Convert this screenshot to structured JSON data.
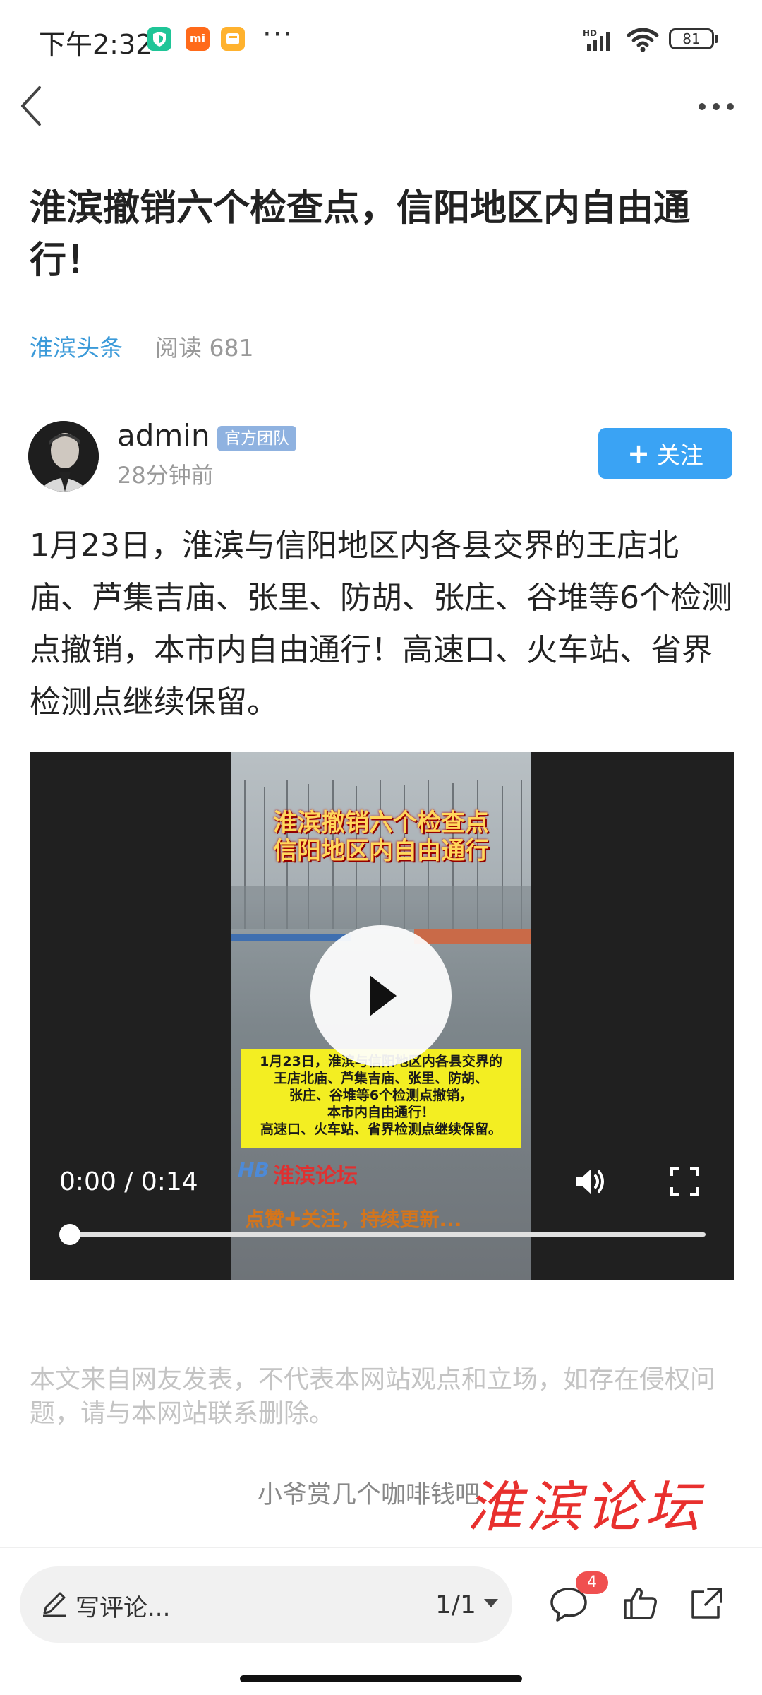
{
  "status_bar": {
    "time": "下午2:32",
    "more": "···",
    "network": "HD",
    "battery": "81"
  },
  "article": {
    "title": "淮滨撤销六个检查点，信阳地区内自由通行！",
    "category": "淮滨头条",
    "read_label": "阅读 681",
    "author": {
      "name": "admin",
      "badge": "官方团队",
      "time": "28分钟前",
      "follow_label": "关注",
      "follow_prefix": "+"
    },
    "body": "1月23日，淮滨与信阳地区内各县交界的王店北庙、芦集吉庙、张里、防胡、张庄、谷堆等6个检测点撤销，本市内自由通行！高速口、火车站、省界检测点继续保留。",
    "video": {
      "overlay_title_1": "淮滨撤销六个检查点",
      "overlay_title_2": "信阳地区内自由通行",
      "overlay_box_1": "1月23日，淮滨与信阳地区内各县交界的",
      "overlay_box_2": "王店北庙、芦集吉庙、张里、防胡、",
      "overlay_box_3": "张庄、谷堆等6个检测点撤销，",
      "overlay_box_4": "本市内自由通行！",
      "overlay_box_5": "高速口、火车站、省界检测点继续保留。",
      "overlay_brand": "淮滨论坛",
      "overlay_cta": "点赞✚关注，持续更新...",
      "time_display": "0:00 / 0:14",
      "progress": 0.0
    },
    "disclaimer": "本文来自网友发表，不代表本网站观点和立场，如存在侵权问题，请与本网站联系删除。",
    "reward": "小爷赏几个咖啡钱吧",
    "watermark": "淮滨论坛"
  },
  "bottom_bar": {
    "comment_placeholder": "写评论...",
    "pager": "1/1",
    "comment_count": "4"
  },
  "colors": {
    "accent": "#3aa3f4",
    "category": "#3b9ad9",
    "badge": "#8fb2e0",
    "notification": "#f05050"
  }
}
